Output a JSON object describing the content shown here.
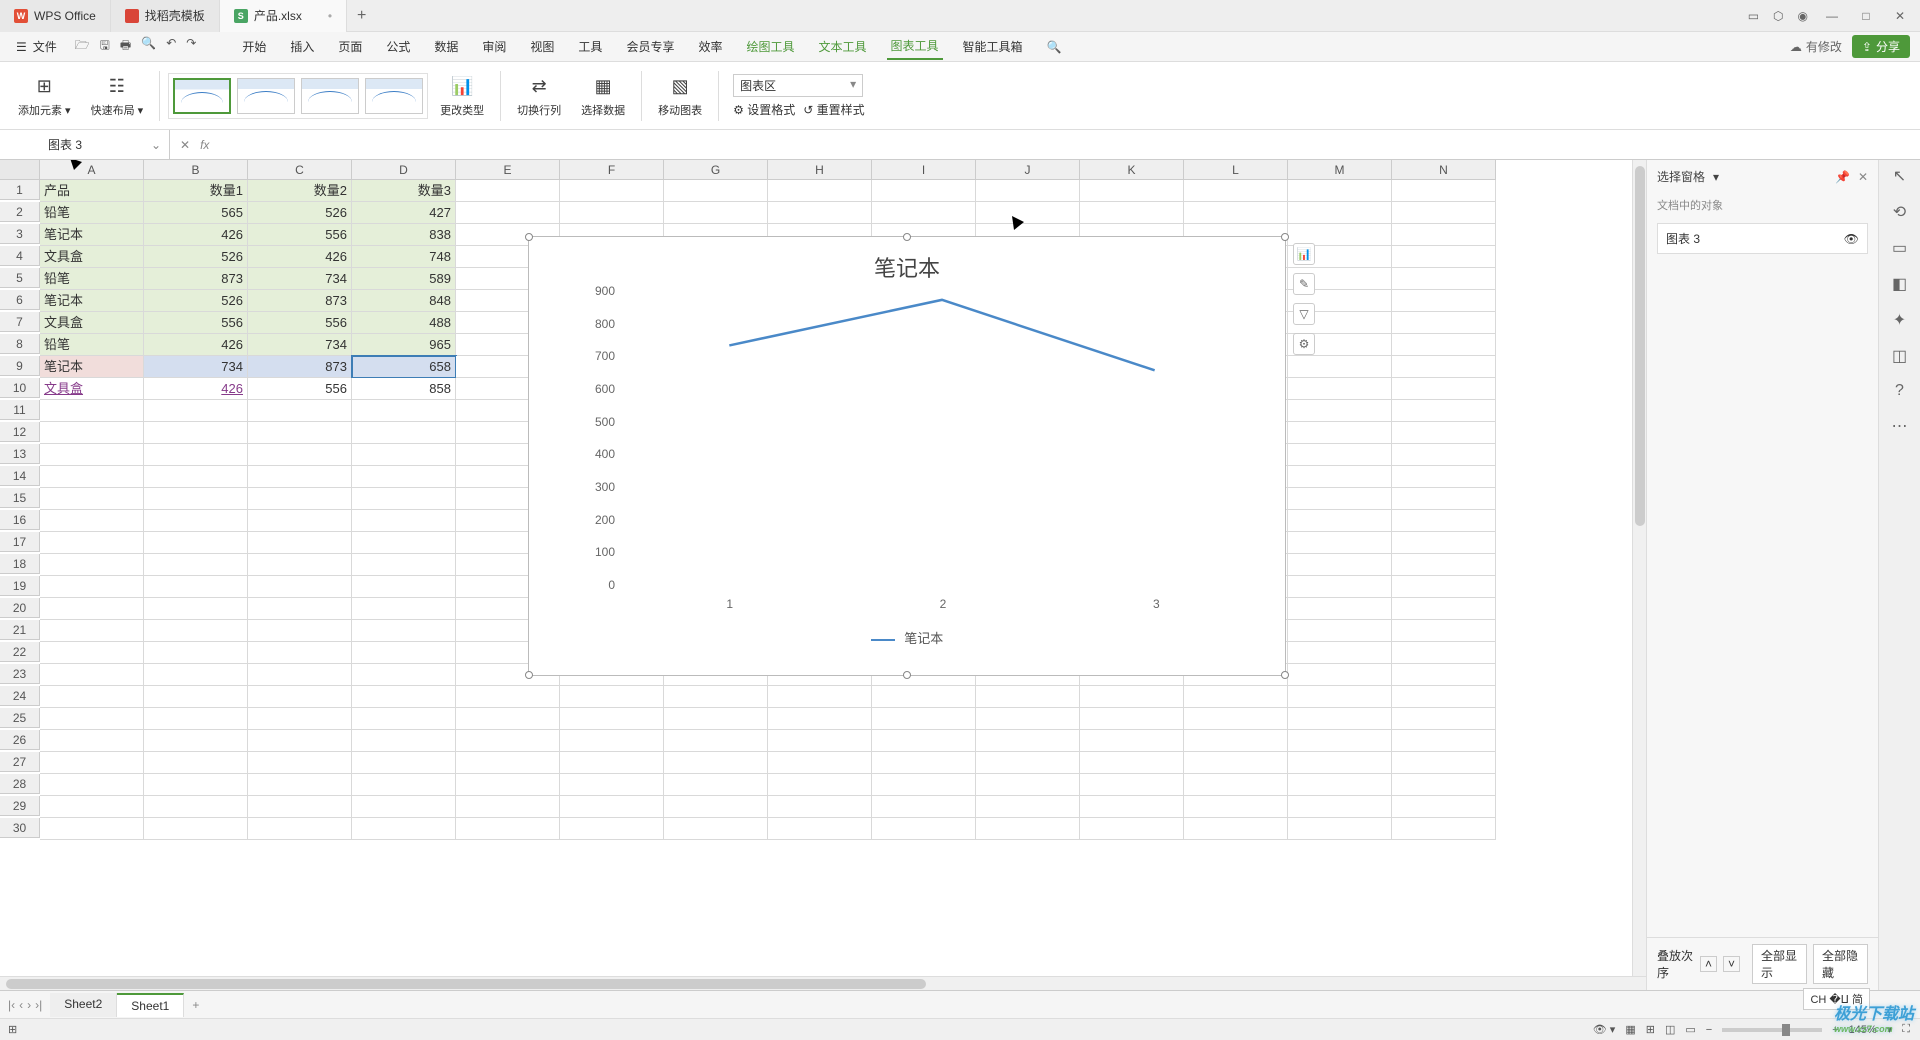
{
  "titlebar": {
    "app": "WPS Office",
    "template_tab": "找稻壳模板",
    "doc_tab": "产品.xlsx",
    "add": "+"
  },
  "window": {
    "min": "—",
    "max": "□",
    "close": "✕"
  },
  "menubar": {
    "file": "文件",
    "tabs": [
      "开始",
      "插入",
      "页面",
      "公式",
      "数据",
      "审阅",
      "视图",
      "工具",
      "会员专享",
      "效率",
      "绘图工具",
      "文本工具",
      "图表工具",
      "智能工具箱"
    ],
    "active_tab": "图表工具",
    "changes": "有修改",
    "share": "分享"
  },
  "ribbon": {
    "add_element": "添加元素",
    "quick_layout": "快速布局",
    "change_type": "更改类型",
    "switch_rowcol": "切换行列",
    "select_data": "选择数据",
    "move_chart": "移动图表",
    "chart_area": "图表区",
    "set_format": "设置格式",
    "reset_style": "重置样式"
  },
  "namebox": "图表 3",
  "formula": "",
  "grid": {
    "cols": [
      "A",
      "B",
      "C",
      "D",
      "E",
      "F",
      "G",
      "H",
      "I",
      "J",
      "K",
      "L",
      "M",
      "N"
    ],
    "rows": 30,
    "header": [
      "产品",
      "数量1",
      "数量2",
      "数量3"
    ],
    "data": [
      [
        "铅笔",
        565,
        526,
        427
      ],
      [
        "笔记本",
        426,
        556,
        838
      ],
      [
        "文具盒",
        526,
        426,
        748
      ],
      [
        "铅笔",
        873,
        734,
        589
      ],
      [
        "笔记本",
        526,
        873,
        848
      ],
      [
        "文具盒",
        556,
        556,
        488
      ],
      [
        "铅笔",
        426,
        734,
        965
      ],
      [
        "笔记本",
        734,
        873,
        658
      ],
      [
        "文具盒",
        "426",
        556,
        858
      ]
    ]
  },
  "chart_data": {
    "type": "line",
    "title": "笔记本",
    "categories": [
      "1",
      "2",
      "3"
    ],
    "series": [
      {
        "name": "笔记本",
        "values": [
          734,
          873,
          658
        ]
      }
    ],
    "ylim": [
      0,
      900
    ],
    "ytick": [
      0,
      100,
      200,
      300,
      400,
      500,
      600,
      700,
      800,
      900
    ],
    "legend": "笔记本"
  },
  "panel": {
    "title": "选择窗格",
    "subtitle": "文档中的对象",
    "item": "图表 3",
    "order": "叠放次序",
    "show_all": "全部显示",
    "hide_all": "全部隐藏"
  },
  "sheets": {
    "tabs": [
      "Sheet2",
      "Sheet1"
    ],
    "active": "Sheet1",
    "add": "+"
  },
  "status": {
    "ime": "CH �ⵡ 简",
    "zoom": "145%",
    "views": [
      "▦",
      "▥",
      "⊞",
      "◫"
    ]
  },
  "watermark": {
    "main": "极光下载站",
    "sub": "www.xz7.com"
  }
}
